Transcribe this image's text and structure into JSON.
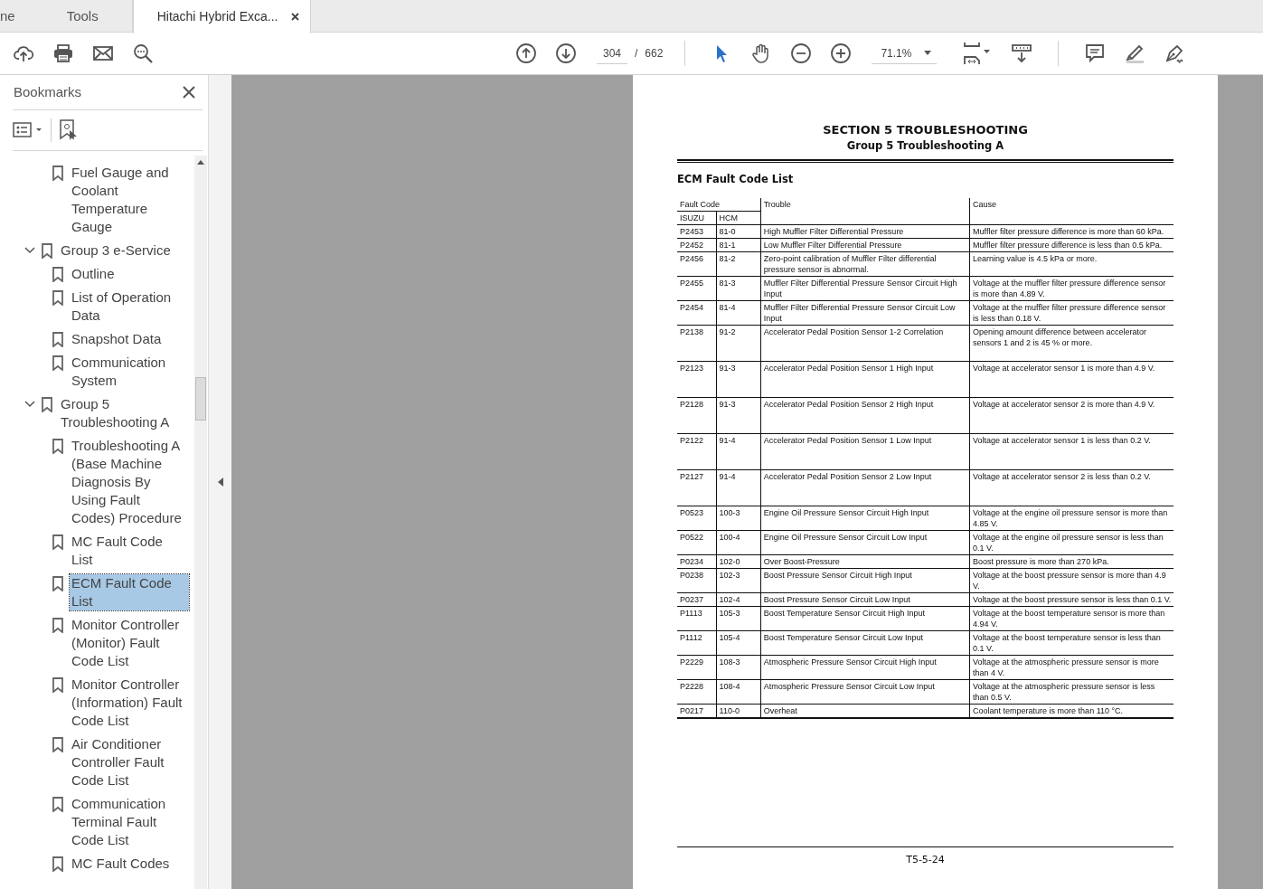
{
  "tabs": [
    {
      "label": "ne",
      "selected": false,
      "closable": false
    },
    {
      "label": "Tools",
      "selected": false,
      "closable": false
    },
    {
      "label": "Hitachi Hybrid Exca...",
      "selected": true,
      "closable": true
    }
  ],
  "toolbar": {
    "page_number": "304",
    "page_separator": "/",
    "page_count": "662",
    "zoom": "71.1%",
    "tools": [
      {
        "kind": "select",
        "selected": true
      },
      {
        "kind": "hand",
        "selected": false
      }
    ]
  },
  "sidebar": {
    "title": "Bookmarks",
    "items": [
      {
        "children": [
          {
            "label": "Fuel Gauge and Coolant Temperature Gauge",
            "selected": false
          }
        ]
      },
      {
        "label": "Group 3 e-Service",
        "selected": false,
        "expanded": true,
        "children": [
          {
            "label": "Outline",
            "selected": false
          },
          {
            "label": "List of Operation Data",
            "selected": false
          },
          {
            "label": "Snapshot Data",
            "selected": false
          },
          {
            "label": "Communication System",
            "selected": false
          }
        ]
      },
      {
        "label": "Group 5 Troubleshooting A",
        "selected": false,
        "expanded": true,
        "children": [
          {
            "label": "Troubleshooting A (Base Machine Diagnosis By Using Fault Codes) Procedure",
            "selected": false
          },
          {
            "label": "MC Fault Code List",
            "selected": false
          },
          {
            "label": "ECM Fault Code List",
            "selected": true
          },
          {
            "label": "Monitor Controller (Monitor) Fault Code List",
            "selected": false
          },
          {
            "label": "Monitor Controller (Information) Fault Code List",
            "selected": false
          },
          {
            "label": "Air Conditioner Controller Fault Code List",
            "selected": false
          },
          {
            "label": "Communication Terminal Fault Code List",
            "selected": false
          },
          {
            "label": "MC Fault Codes",
            "selected": false
          }
        ]
      }
    ]
  },
  "document": {
    "section_title": "SECTION 5 TROUBLESHOOTING",
    "group_title": "Group 5 Troubleshooting A",
    "heading": "ECM Fault Code List",
    "table": {
      "group_header": "Fault Code",
      "columns": [
        "ISUZU",
        "HCM",
        "Trouble",
        "Cause"
      ],
      "rows": [
        [
          "P2453",
          "81-0",
          "High Muffler Filter Differential Pressure",
          "Muffler filter pressure difference is more than 60 kPa."
        ],
        [
          "P2452",
          "81-1",
          "Low Muffler Filter Differential Pressure",
          "Muffler filter pressure difference is less than 0.5 kPa."
        ],
        [
          "P2456",
          "81-2",
          "Zero-point calibration of Muffler Filter differential pressure sensor is abnormal.",
          "Learning value is 4.5 kPa or more."
        ],
        [
          "P2455",
          "81-3",
          "Muffler Filter Differential Pressure Sensor Circuit High Input",
          "Voltage at the muffler filter pressure difference sensor is more than 4.89 V."
        ],
        [
          "P2454",
          "81-4",
          "Muffler Filter Differential Pressure Sensor Circuit Low Input",
          "Voltage at the muffler filter pressure difference sensor is less than 0.18 V."
        ],
        [
          "P2138",
          "91-2",
          "Accelerator Pedal Position Sensor 1-2 Correlation",
          "Opening amount difference between accelerator sensors 1 and 2 is 45 % or more."
        ],
        [
          "P2123",
          "91-3",
          "Accelerator Pedal Position Sensor 1 High Input",
          "Voltage at accelerator sensor 1 is more than 4.9 V."
        ],
        [
          "P2128",
          "91-3",
          "Accelerator Pedal Position Sensor 2 High Input",
          "Voltage at accelerator sensor 2 is more than 4.9 V."
        ],
        [
          "P2122",
          "91-4",
          "Accelerator Pedal Position Sensor 1 Low Input",
          "Voltage at accelerator sensor 1 is less than 0.2 V."
        ],
        [
          "P2127",
          "91-4",
          "Accelerator Pedal Position Sensor 2 Low Input",
          "Voltage at accelerator sensor 2 is less than 0.2 V."
        ],
        [
          "P0523",
          "100-3",
          "Engine Oil Pressure Sensor Circuit High Input",
          "Voltage at the engine oil pressure sensor is more than 4.85 V."
        ],
        [
          "P0522",
          "100-4",
          "Engine Oil Pressure Sensor Circuit Low Input",
          "Voltage at the engine oil pressure sensor is less than 0.1 V."
        ],
        [
          "P0234",
          "102-0",
          "Over Boost-Pressure",
          "Boost pressure is more than 270 kPa."
        ],
        [
          "P0238",
          "102-3",
          "Boost Pressure Sensor Circuit High Input",
          "Voltage at the boost pressure sensor is more than 4.9 V."
        ],
        [
          "P0237",
          "102-4",
          "Boost Pressure Sensor Circuit Low Input",
          "Voltage at the boost pressure sensor is less than 0.1 V."
        ],
        [
          "P1113",
          "105-3",
          "Boost Temperature Sensor Circuit High Input",
          "Voltage at the boost temperature sensor is more than 4.94 V."
        ],
        [
          "P1112",
          "105-4",
          "Boost Temperature Sensor Circuit Low Input",
          "Voltage at the boost temperature sensor is less than 0.1 V."
        ],
        [
          "P2229",
          "108-3",
          "Atmospheric Pressure Sensor Circuit High Input",
          "Voltage at the atmospheric pressure sensor is more than 4 V."
        ],
        [
          "P2228",
          "108-4",
          "Atmospheric Pressure Sensor Circuit Low Input",
          "Voltage at the atmospheric pressure sensor is less than 0.5 V."
        ],
        [
          "P0217",
          "110-0",
          "Overheat",
          "Coolant temperature is more than 110 °C."
        ]
      ]
    },
    "page_label": "T5-5-24"
  }
}
